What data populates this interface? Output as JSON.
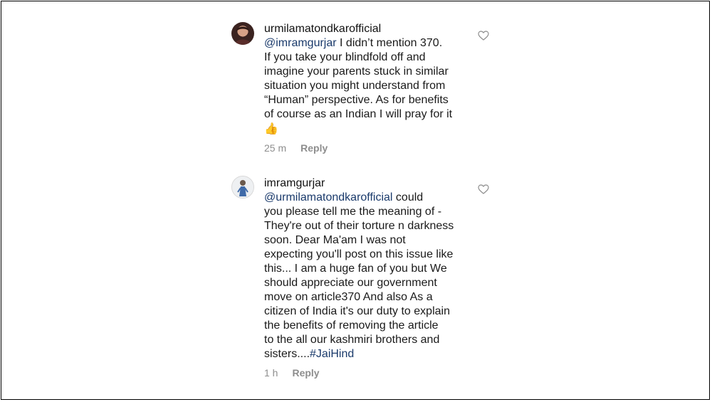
{
  "comments": [
    {
      "username": "urmilamatondkarofficial",
      "mention": "@imramgurjar",
      "lines": [
        " I didn’t mention 370.",
        "If you take your blindfold off and",
        "imagine your parents stuck in similar",
        "situation you might understand from",
        "“Human” perspective. As for benefits",
        "of course as an Indian I will pray for it",
        "👍"
      ],
      "time": "25 m",
      "reply": "Reply",
      "avatar_icon": "profile-photo-icon",
      "like_icon": "heart-outline-icon"
    },
    {
      "username": "imramgurjar",
      "mention": "@urmilamatondkarofficial",
      "lines": [
        " could",
        "you please tell me the meaning of -",
        "They're out of their torture n darkness",
        "soon.  Dear Ma'am I was not",
        "expecting you'll post on this issue like",
        "this... I am a huge fan of you but We",
        "should appreciate our government",
        "move on article370 And  also As a",
        "citizen of India it's our duty to explain",
        "the benefits of removing the article",
        "to the all our kashmiri brothers and",
        "sisters...."
      ],
      "hashtag": "#JaiHind",
      "time": "1 h",
      "reply": "Reply",
      "avatar_icon": "profile-photo-icon",
      "like_icon": "heart-outline-icon"
    }
  ]
}
